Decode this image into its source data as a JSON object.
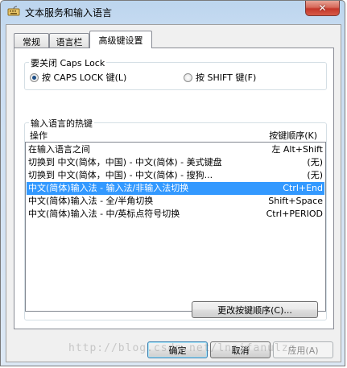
{
  "window": {
    "title": "文本服务和输入语言",
    "close_label": "✕"
  },
  "tabs": [
    {
      "label": "常规",
      "active": false
    },
    {
      "label": "语言栏",
      "active": false
    },
    {
      "label": "高级键设置",
      "active": true
    }
  ],
  "caps_lock": {
    "group_label": "要关闭 Caps Lock",
    "options": [
      {
        "label": "按 CAPS LOCK 键(L)",
        "selected": true
      },
      {
        "label": "按 SHIFT 键(F)",
        "selected": false
      }
    ]
  },
  "hotkeys": {
    "group_label": "输入语言的热键",
    "col_action": "操作",
    "col_sequence": "按键顺序(K)",
    "rows": [
      {
        "action": "在输入语言之间",
        "keys": "左 Alt+Shift",
        "selected": false
      },
      {
        "action": "切换到 中文(简体，中国) - 中文(简体) - 美式键盘",
        "keys": "(无)",
        "selected": false
      },
      {
        "action": "切换到 中文(简体，中国) - 中文(简体) - 搜狗...",
        "keys": "(无)",
        "selected": false
      },
      {
        "action": "中文(简体)输入法 - 输入法/非输入法切换",
        "keys": "Ctrl+End",
        "selected": true
      },
      {
        "action": "中文(简体)输入法 - 全/半角切换",
        "keys": "Shift+Space",
        "selected": false
      },
      {
        "action": "中文(简体)输入法 - 中/英标点符号切换",
        "keys": "Ctrl+PERIOD",
        "selected": false
      }
    ],
    "change_button": "更改按键顺序(C)..."
  },
  "footer": {
    "ok": "确定",
    "cancel": "取消",
    "apply": "应用(A)"
  },
  "watermark": "http://blog.csdn.net/lnaifanulzq"
}
